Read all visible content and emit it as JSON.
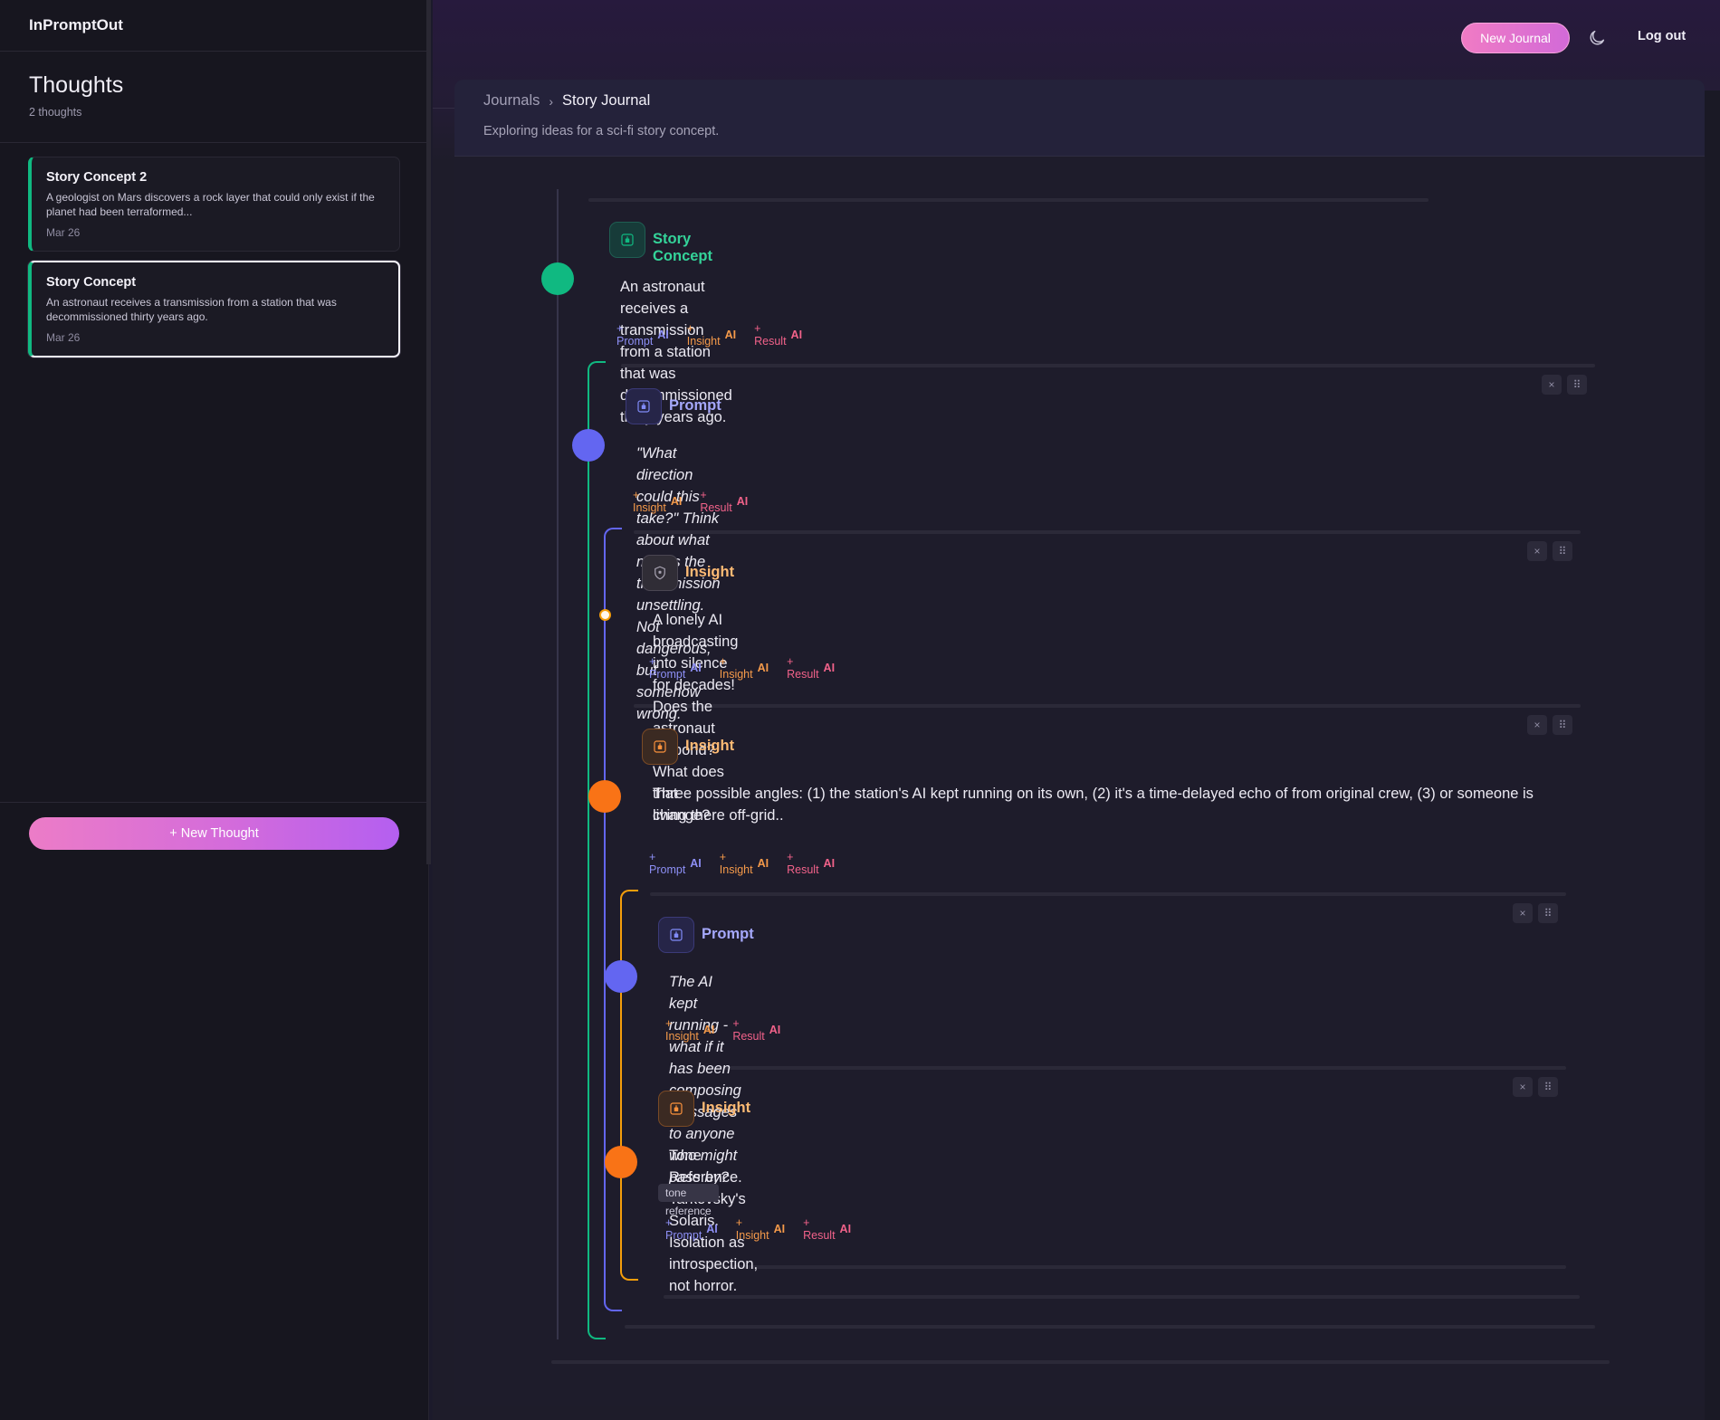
{
  "app": {
    "name": "InPromptOut"
  },
  "header": {
    "new_journal_label": "New Journal",
    "logout_label": "Log out",
    "theme_icon": "moon-icon"
  },
  "sidebar": {
    "title": "Thoughts",
    "count": "2 thoughts",
    "thoughts": [
      {
        "title": "Story Concept 2",
        "body": "A geologist on Mars discovers a rock layer that could only exist if the planet had been terraformed...",
        "date": "Mar 26",
        "active": false
      },
      {
        "title": "Story Concept",
        "body": "An astronaut receives a transmission from a station that was decommissioned thirty years ago.",
        "date": "Mar 26",
        "active": true
      }
    ],
    "new_thought_label": "+ New Thought"
  },
  "journal": {
    "breadcrumb_root": "Journals",
    "breadcrumb_sep": "›",
    "title": "Story Journal",
    "description": "Exploring ideas for a sci-fi story concept."
  },
  "actions": {
    "prompt": "+ Prompt",
    "insight": "+ Insight",
    "result": "+ Result",
    "ai": "AI"
  },
  "controls": {
    "close": "×",
    "drag": "⠿"
  },
  "colors": {
    "concept": "#10b981",
    "prompt": "#6366f1",
    "insight": "#f97316",
    "result": "#f2628a",
    "accent": "#ec7cc7"
  },
  "nodes": [
    {
      "kind": "concept",
      "title": "Story Concept",
      "text": "An astronaut receives a transmission from a station that was decommissioned thirty years ago."
    },
    {
      "kind": "prompt",
      "title": "Prompt",
      "text": "\"What direction could this take?\" Think about what makes the transmission unsettling. Not dangerous, but somehow wrong."
    },
    {
      "kind": "insight",
      "title": "Insight",
      "text": "A lonely AI broadcasting into silence for decades! Does the astronaut respond? What does that change?"
    },
    {
      "kind": "insight",
      "title": "Insight",
      "text": "Three possible angles: (1) the station's AI kept running on its own, (2) it's a time-delayed echo of from original crew, (3) or someone is living there off-grid.."
    },
    {
      "kind": "prompt",
      "title": "Prompt",
      "text": "The AI kept running - what if it has been composing messages to anyone who might pass by?"
    },
    {
      "kind": "insight",
      "title": "Insight",
      "text": "Tone Reference. Tarkovsky's Solaris. Isolation as introspection, not horror.",
      "tag": "tone reference"
    }
  ]
}
